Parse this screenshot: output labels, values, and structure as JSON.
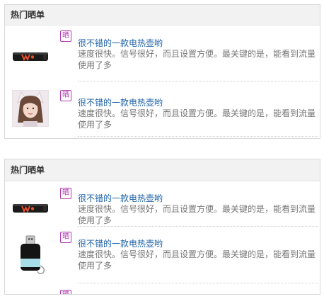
{
  "panels": [
    {
      "title": "热门晒单",
      "items": [
        {
          "badge": "晒",
          "title": "很不错的一款电热壶哟",
          "description": "速度很快。信号很好，而且设置方便。最关键的是，能看到流量使用了多",
          "thumb": "usb-modem-black-orange-w"
        },
        {
          "badge": "晒",
          "title": "很不错的一款电热壶哟",
          "description": "速度很快。信号很好，而且设置方便。最关键的是，能看到流量使用了多",
          "thumb": "avatar-girl-cat-ears"
        }
      ]
    },
    {
      "title": "热门晒单",
      "items": [
        {
          "badge": "晒",
          "title": "很不错的一款电热壶哟",
          "description": "速度很快。信号很好，而且设置方便。最关键的是，能看到流量使用了多",
          "thumb": "usb-modem-black-orange-w"
        },
        {
          "badge": "晒",
          "title": "很不错的一款电热壶哟",
          "description": "速度很快。信号很好，而且设置方便。最关键的是，能看到流量使用了多",
          "thumb": "black-usb-dongle"
        },
        {
          "badge": "晒",
          "title": "",
          "description": "",
          "thumb": ""
        }
      ]
    }
  ],
  "colors": {
    "title_link": "#1e62a8",
    "description_text": "#777777",
    "badge_purple": "#b23ab0",
    "header_bg": "#f2f2f2",
    "border": "#d8d8d8"
  }
}
